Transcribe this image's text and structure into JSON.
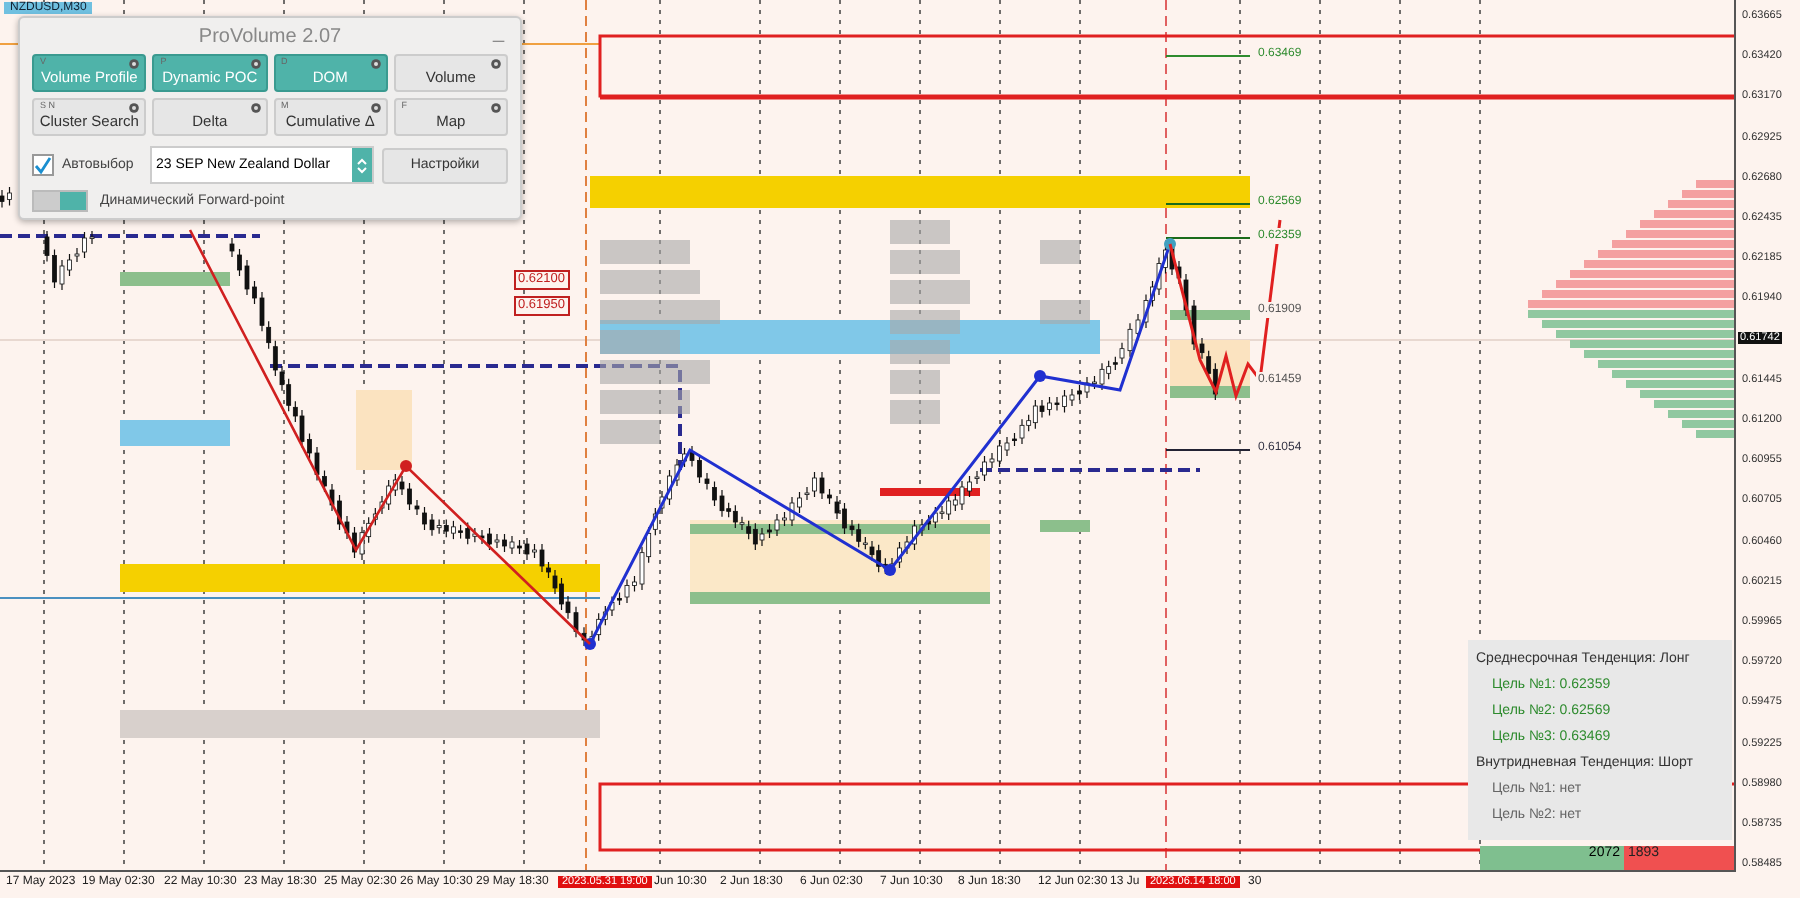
{
  "symbol_tag": "NZDUSD,M30",
  "panel": {
    "title": "ProVolume 2.07",
    "minimize": "_",
    "buttons": [
      {
        "label": "Volume Profile",
        "hotkey": "V",
        "selected": true
      },
      {
        "label": "Dynamic POC",
        "hotkey": "P",
        "selected": true
      },
      {
        "label": "DOM",
        "hotkey": "D",
        "selected": true
      },
      {
        "label": "Volume",
        "selected": false
      },
      {
        "label": "Cluster Search",
        "hotkey": "S N",
        "selected": false
      },
      {
        "label": "Delta",
        "selected": false
      },
      {
        "label": "Cumulative Δ",
        "hotkey": "M",
        "selected": false
      },
      {
        "label": "Map",
        "hotkey": "F",
        "selected": false
      }
    ],
    "autoselect": {
      "label": "Автовыбор",
      "checked": true
    },
    "instrument": {
      "value": "23 SEP New Zealand Dollar"
    },
    "settings_button": "Настройки",
    "forward_point": {
      "label": "Динамический Forward-point",
      "on": true
    }
  },
  "chart_levels": [
    "0.63469",
    "0.62569",
    "0.62359",
    "0.61909",
    "0.61459",
    "0.61054"
  ],
  "chart_tags": [
    "0.62100",
    "0.61950"
  ],
  "price_axis": [
    "0.63665",
    "0.63420",
    "0.63170",
    "0.62925",
    "0.62680",
    "0.62435",
    "0.62185",
    "0.61940",
    "0.61445",
    "0.61200",
    "0.60955",
    "0.60705",
    "0.60460",
    "0.60215",
    "0.59965",
    "0.59720",
    "0.59475",
    "0.59225",
    "0.58980",
    "0.58735",
    "0.58485"
  ],
  "current_price": "0.61742",
  "time_axis": [
    {
      "label": "17 May 2023",
      "highlighted": false
    },
    {
      "label": "19 May 02:30",
      "highlighted": false
    },
    {
      "label": "22 May 10:30",
      "highlighted": false
    },
    {
      "label": "23 May 18:30",
      "highlighted": false
    },
    {
      "label": "25 May 02:30",
      "highlighted": false
    },
    {
      "label": "26 May 10:30",
      "highlighted": false
    },
    {
      "label": "29 May 18:30",
      "highlighted": false
    },
    {
      "label": "2023.05.31 19:00",
      "highlighted": true
    },
    {
      "label": "Jun 10:30",
      "highlighted": false
    },
    {
      "label": "2 Jun 18:30",
      "highlighted": false
    },
    {
      "label": "6 Jun 02:30",
      "highlighted": false
    },
    {
      "label": "7 Jun 10:30",
      "highlighted": false
    },
    {
      "label": "8 Jun 18:30",
      "highlighted": false
    },
    {
      "label": "12 Jun 02:30",
      "highlighted": false
    },
    {
      "label": "13 Ju",
      "highlighted": false
    },
    {
      "label": "2023.06.14 18:00",
      "highlighted": true
    },
    {
      "label": "30",
      "highlighted": false
    }
  ],
  "trend_box": {
    "lines": [
      {
        "text": "Среднесрочная Тенденция: Лонг",
        "kind": "heading"
      },
      {
        "text": "Цель №1: 0.62359",
        "kind": "target"
      },
      {
        "text": "Цель №2: 0.62569",
        "kind": "target"
      },
      {
        "text": "Цель №3: 0.63469",
        "kind": "target"
      },
      {
        "text": "Внутридневная Тенденция: Шорт",
        "kind": "heading"
      },
      {
        "text": "Цель №1: нет",
        "kind": "none"
      },
      {
        "text": "Цель №2: нет",
        "kind": "none"
      }
    ]
  },
  "balance": {
    "buy": "2072",
    "sell": "1893"
  }
}
